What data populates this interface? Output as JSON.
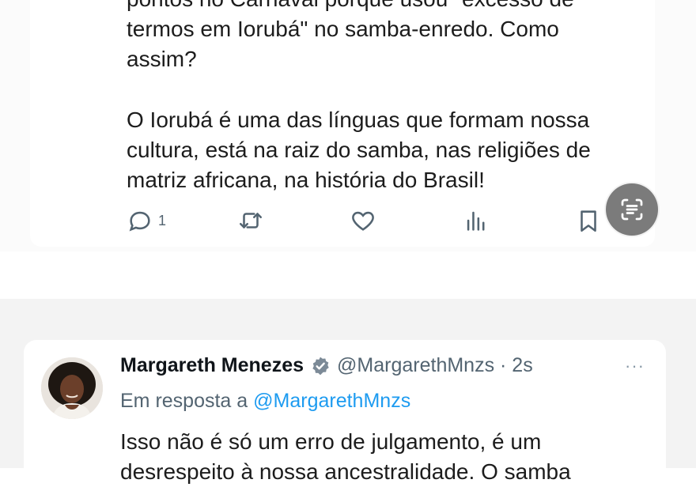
{
  "top_tweet": {
    "paragraph1": "pontos no Carnaval porque usou \"excesso de\ntermos em Iorubá\" no samba-enredo. Como\nassim?",
    "paragraph2": "O Iorubá é uma das línguas que formam nossa\ncultura, está na raiz do samba, nas religiões de\nmatriz africana, na história do Brasil!",
    "actions": {
      "reply_icon": "reply-icon",
      "reply_count": "1",
      "retweet_icon": "retweet-icon",
      "like_icon": "heart-icon",
      "views_icon": "views-icon",
      "bookmark_icon": "bookmark-icon"
    },
    "overlay_button_icon": "scan-text-icon"
  },
  "reply_tweet": {
    "author_name": "Margareth Menezes",
    "handle_time": "@MargarethMnzs · 2s",
    "more": "···",
    "reply_prefix": "Em resposta a",
    "reply_mention": "@MargarethMnzs",
    "text": "Isso não é só um erro de julgamento, é um\ndesrespeito à nossa ancestralidade. O samba"
  },
  "colors": {
    "text": "#1c1c1c",
    "secondary": "#536471",
    "link": "#1d9bf0",
    "verified": "#7c8a97"
  }
}
